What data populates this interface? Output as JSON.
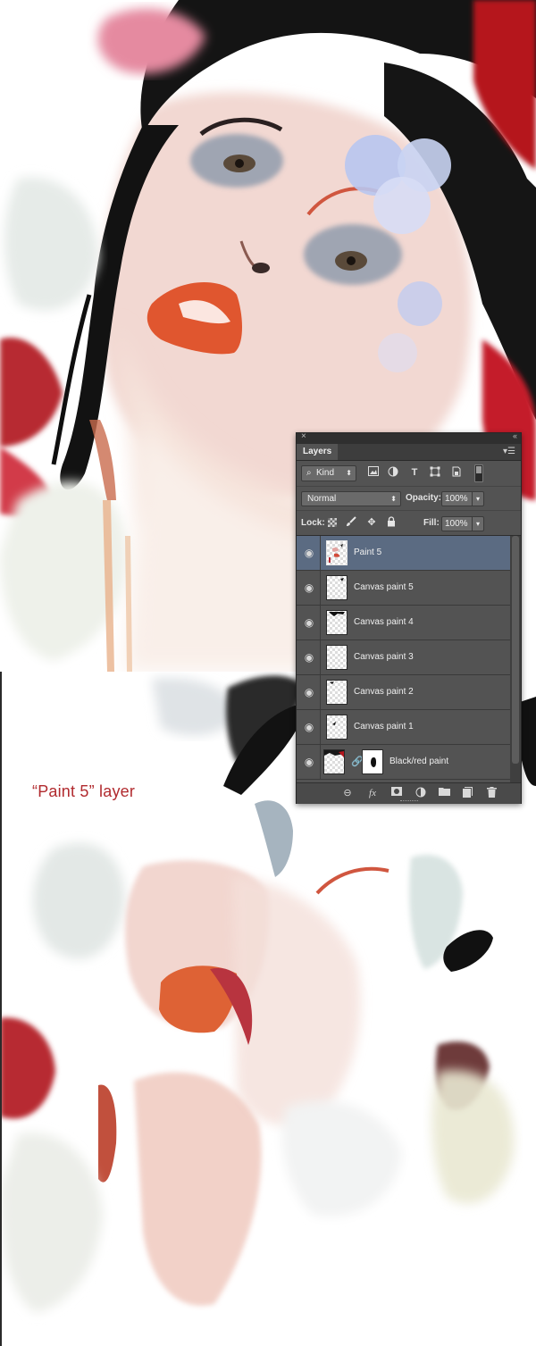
{
  "caption": "“Paint 5” layer",
  "panel": {
    "close_glyph": "×",
    "collapse_glyph": "‹‹",
    "tab_label": "Layers",
    "menu_icon": "panel-menu-icon",
    "filter": {
      "kind_label": "Kind",
      "kind_arrow": "⬍",
      "search_icon_glyph": "⌕",
      "icons": [
        "image-filter-icon",
        "adjustment-filter-icon",
        "type-filter-icon",
        "shape-filter-icon",
        "smart-object-filter-icon"
      ]
    },
    "blend": {
      "mode": "Normal",
      "opacity_label": "Opacity:",
      "opacity_value": "100%",
      "fill_label": "Fill:",
      "fill_value": "100%"
    },
    "lock_label": "Lock:",
    "layers": [
      {
        "name": "Paint 5",
        "selected": true,
        "visible": true
      },
      {
        "name": "Canvas paint 5",
        "selected": false,
        "visible": true
      },
      {
        "name": "Canvas paint 4",
        "selected": false,
        "visible": true
      },
      {
        "name": "Canvas paint 3",
        "selected": false,
        "visible": true
      },
      {
        "name": "Canvas paint 2",
        "selected": false,
        "visible": true
      },
      {
        "name": "Canvas paint 1",
        "selected": false,
        "visible": true
      },
      {
        "name": "Black/red paint",
        "selected": false,
        "visible": true,
        "has_mask": true
      }
    ],
    "bottom_icons": [
      "link-layers-icon",
      "fx-icon",
      "add-mask-icon",
      "adjustment-layer-icon",
      "new-group-icon",
      "new-layer-icon",
      "trash-icon"
    ],
    "fx_label": "fx"
  },
  "colors": {
    "panel_bg": "#535353",
    "selected_row": "#5b6b82",
    "caption_red": "#b12a2e"
  }
}
